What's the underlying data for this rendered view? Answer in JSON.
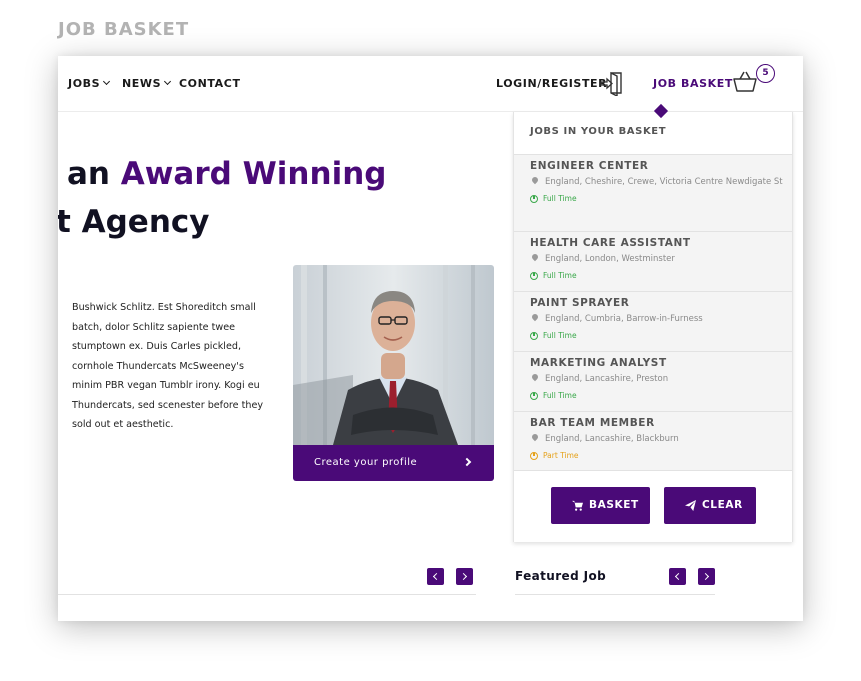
{
  "page_label": "JOB BASKET",
  "nav": {
    "items": [
      {
        "label": "JOBS",
        "has_dropdown": true
      },
      {
        "label": "NEWS",
        "has_dropdown": true
      },
      {
        "label": "CONTACT",
        "has_dropdown": false
      }
    ],
    "login_label": "LOGIN/REGISTER",
    "login_icon": "login-icon",
    "basket_label": "JOB BASKET",
    "basket_icon": "basket-icon",
    "basket_count": "5"
  },
  "hero": {
    "line1_prefix": "an",
    "line1_accent": "Award Winning",
    "line2": "t Agency",
    "body": "Bushwick Schlitz. Est Shoreditch small batch, dolor Schlitz sapiente twee stumptown ex. Duis Carles pickled, cornhole Thundercats McSweeney's minim PBR vegan Tumblr irony. Kogi eu Thundercats, sed scenester before they sold out et aesthetic."
  },
  "profile_card": {
    "cta_label": "Create your profile"
  },
  "basket_dropdown": {
    "title": "JOBS IN YOUR BASKET",
    "jobs": [
      {
        "title": "ENGINEER CENTER",
        "location": "England, Cheshire, Crewe, Victoria Centre Newdigate St",
        "type": "Full Time"
      },
      {
        "title": "HEALTH CARE ASSISTANT",
        "location": "England, London, Westminster",
        "type": "Full Time"
      },
      {
        "title": "PAINT SPRAYER",
        "location": "England, Cumbria, Barrow-in-Furness",
        "type": "Full Time"
      },
      {
        "title": "MARKETING ANALYST",
        "location": "England, Lancashire, Preston",
        "type": "Full Time"
      },
      {
        "title": "BAR TEAM MEMBER",
        "location": "England, Lancashire, Blackburn",
        "type": "Part Time"
      }
    ],
    "basket_button": "BASKET",
    "clear_button": "CLEAR"
  },
  "featured": {
    "title": "Featured Job"
  },
  "colors": {
    "accent": "#4a0a78",
    "full_time": "#3aa84a",
    "part_time": "#e5a21b"
  }
}
